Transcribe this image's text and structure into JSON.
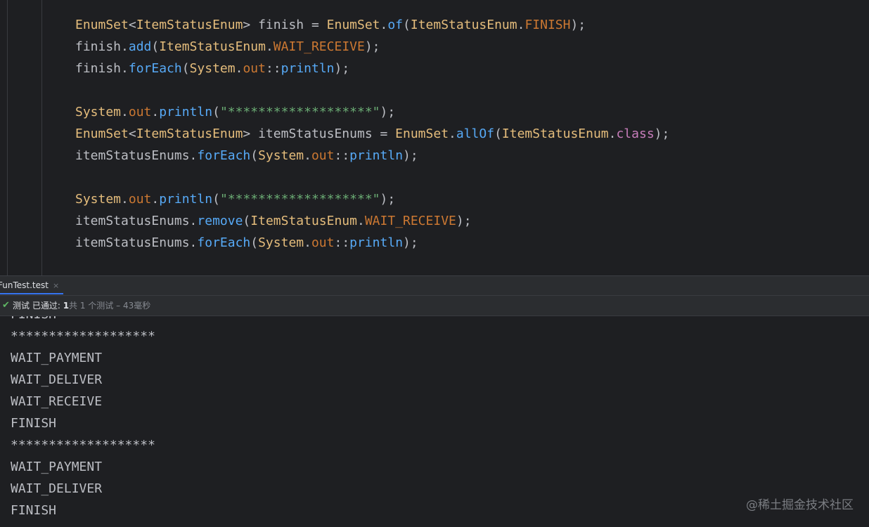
{
  "editor": {
    "lines": [
      [
        [
          "EnumSet",
          "type"
        ],
        [
          "<",
          "plain"
        ],
        [
          "ItemStatusEnum",
          "type"
        ],
        [
          "> finish = ",
          "plain"
        ],
        [
          "EnumSet",
          "type"
        ],
        [
          ".",
          "plain"
        ],
        [
          "of",
          "method"
        ],
        [
          "(",
          "plain"
        ],
        [
          "ItemStatusEnum",
          "type"
        ],
        [
          ".",
          "plain"
        ],
        [
          "FINISH",
          "const"
        ],
        [
          ");",
          "plain"
        ]
      ],
      [
        [
          "finish.",
          "plain"
        ],
        [
          "add",
          "method"
        ],
        [
          "(",
          "plain"
        ],
        [
          "ItemStatusEnum",
          "type"
        ],
        [
          ".",
          "plain"
        ],
        [
          "WAIT_RECEIVE",
          "const"
        ],
        [
          ");",
          "plain"
        ]
      ],
      [
        [
          "finish.",
          "plain"
        ],
        [
          "forEach",
          "method"
        ],
        [
          "(",
          "plain"
        ],
        [
          "System",
          "type"
        ],
        [
          ".",
          "plain"
        ],
        [
          "out",
          "const"
        ],
        [
          "::",
          "plain"
        ],
        [
          "println",
          "method"
        ],
        [
          ");",
          "plain"
        ]
      ],
      [],
      [
        [
          "System",
          "type"
        ],
        [
          ".",
          "plain"
        ],
        [
          "out",
          "const"
        ],
        [
          ".",
          "plain"
        ],
        [
          "println",
          "method"
        ],
        [
          "(",
          "plain"
        ],
        [
          "\"*******************\"",
          "str"
        ],
        [
          ");",
          "plain"
        ]
      ],
      [
        [
          "EnumSet",
          "type"
        ],
        [
          "<",
          "plain"
        ],
        [
          "ItemStatusEnum",
          "type"
        ],
        [
          "> itemStatusEnums = ",
          "plain"
        ],
        [
          "EnumSet",
          "type"
        ],
        [
          ".",
          "plain"
        ],
        [
          "allOf",
          "method"
        ],
        [
          "(",
          "plain"
        ],
        [
          "ItemStatusEnum",
          "type"
        ],
        [
          ".",
          "plain"
        ],
        [
          "class",
          "kw"
        ],
        [
          ");",
          "plain"
        ]
      ],
      [
        [
          "itemStatusEnums.",
          "plain"
        ],
        [
          "forEach",
          "method"
        ],
        [
          "(",
          "plain"
        ],
        [
          "System",
          "type"
        ],
        [
          ".",
          "plain"
        ],
        [
          "out",
          "const"
        ],
        [
          "::",
          "plain"
        ],
        [
          "println",
          "method"
        ],
        [
          ");",
          "plain"
        ]
      ],
      [],
      [
        [
          "System",
          "type"
        ],
        [
          ".",
          "plain"
        ],
        [
          "out",
          "const"
        ],
        [
          ".",
          "plain"
        ],
        [
          "println",
          "method"
        ],
        [
          "(",
          "plain"
        ],
        [
          "\"*******************\"",
          "str"
        ],
        [
          ");",
          "plain"
        ]
      ],
      [
        [
          "itemStatusEnums.",
          "plain"
        ],
        [
          "remove",
          "method"
        ],
        [
          "(",
          "plain"
        ],
        [
          "ItemStatusEnum",
          "type"
        ],
        [
          ".",
          "plain"
        ],
        [
          "WAIT_RECEIVE",
          "const"
        ],
        [
          ");",
          "plain"
        ]
      ],
      [
        [
          "itemStatusEnums.",
          "plain"
        ],
        [
          "forEach",
          "method"
        ],
        [
          "(",
          "plain"
        ],
        [
          "System",
          "type"
        ],
        [
          ".",
          "plain"
        ],
        [
          "out",
          "const"
        ],
        [
          "::",
          "plain"
        ],
        [
          "println",
          "method"
        ],
        [
          ");",
          "plain"
        ]
      ]
    ]
  },
  "run_panel": {
    "tab_label": "FunTest.test",
    "tab_close": "×",
    "status": {
      "icon": "check-icon",
      "label": "测试 已通过: ",
      "count": "1",
      "summary": "共 1 个测试 – 43毫秒"
    },
    "console_lines": [
      "FINISH",
      "*******************",
      "WAIT_PAYMENT",
      "WAIT_DELIVER",
      "WAIT_RECEIVE",
      "FINISH",
      "*******************",
      "WAIT_PAYMENT",
      "WAIT_DELIVER",
      "FINISH"
    ]
  },
  "watermark": "@稀土掘金技术社区"
}
